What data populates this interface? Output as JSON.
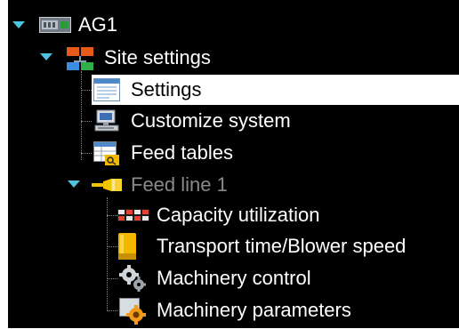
{
  "tree": {
    "root": {
      "label": "AG1",
      "icon": "device-icon",
      "expanded": true
    },
    "site_settings": {
      "label": "Site settings",
      "icon": "network-icon",
      "expanded": true,
      "items": [
        {
          "label": "Settings",
          "icon": "window-icon",
          "selected": true
        },
        {
          "label": "Customize system",
          "icon": "computer-icon"
        },
        {
          "label": "Feed tables",
          "icon": "table-icon"
        }
      ]
    },
    "feed_line": {
      "label": "Feed line 1",
      "icon": "feed-pipe-icon",
      "expanded": true,
      "items": [
        {
          "label": "Capacity utilization",
          "icon": "capacity-grid-icon"
        },
        {
          "label": "Transport time/Blower speed",
          "icon": "blower-icon"
        },
        {
          "label": "Machinery control",
          "icon": "gears-icon"
        },
        {
          "label": "Machinery parameters",
          "icon": "machinery-settings-icon"
        }
      ]
    }
  },
  "colors": {
    "background": "#000000",
    "selected_background": "#ffffff",
    "expander": "#4ec3e0",
    "disabled_text": "#8a8a8a"
  }
}
